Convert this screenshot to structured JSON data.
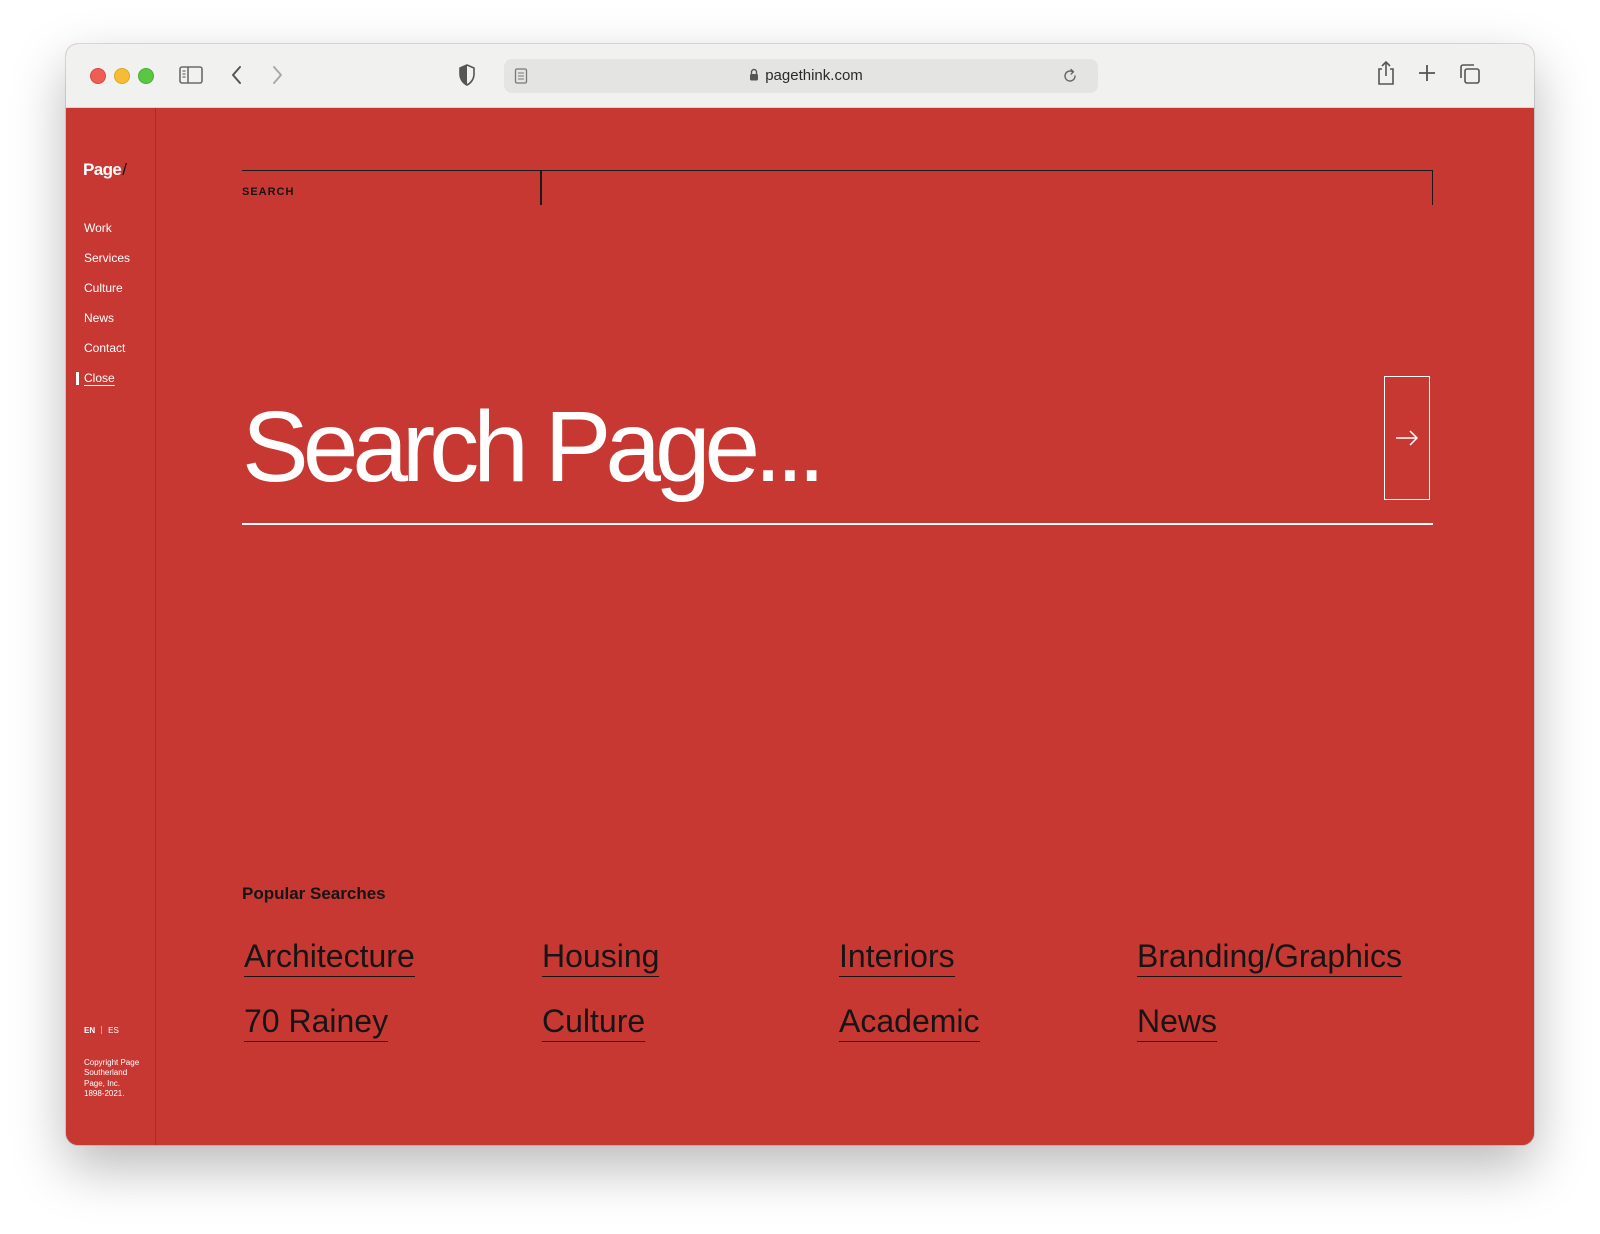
{
  "browser": {
    "url": "pagethink.com"
  },
  "sidebar": {
    "logo": "Page",
    "logo_slash": "/",
    "nav": [
      "Work",
      "Services",
      "Culture",
      "News",
      "Contact",
      "Close"
    ],
    "active_item": "Close",
    "languages": {
      "en": "EN",
      "es": "ES",
      "active": "EN"
    },
    "copyright": "Copyright Page Southerland Page, Inc. 1898-2021."
  },
  "search": {
    "label": "SEARCH",
    "placeholder": "Search Page...",
    "submit_icon": "arrow-right-icon"
  },
  "popular": {
    "title": "Popular Searches",
    "links": [
      "Architecture",
      "Housing",
      "Interiors",
      "Branding/Graphics",
      "70 Rainey",
      "Culture",
      "Academic",
      "News"
    ]
  },
  "colors": {
    "background": "#c83833",
    "text_dark": "#151515",
    "text_light": "#ffffff"
  }
}
